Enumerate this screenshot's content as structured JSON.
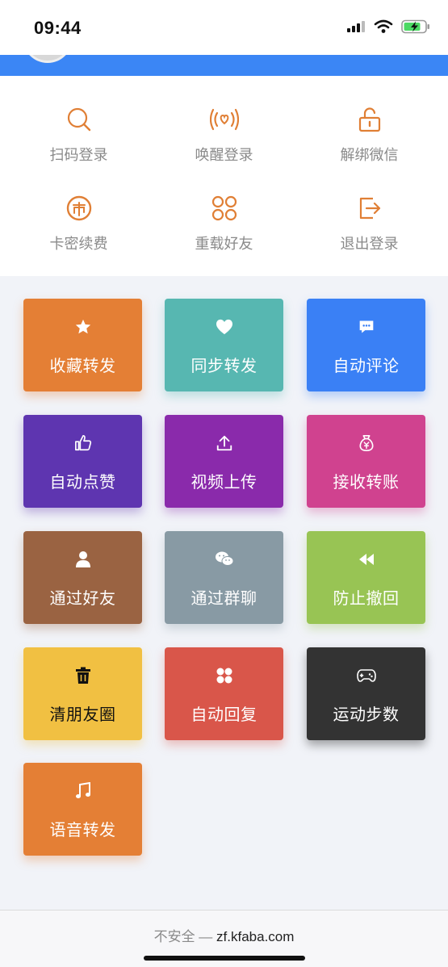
{
  "status_bar": {
    "time": "09:44"
  },
  "menu": {
    "items": [
      {
        "label": "扫码登录",
        "icon": "search-icon"
      },
      {
        "label": "唤醒登录",
        "icon": "wake-signal-icon"
      },
      {
        "label": "解绑微信",
        "icon": "unlock-icon"
      },
      {
        "label": "卡密续费",
        "icon": "coin-icon"
      },
      {
        "label": "重载好友",
        "icon": "reload-grid-icon"
      },
      {
        "label": "退出登录",
        "icon": "logout-icon"
      }
    ],
    "icon_color": "#e07f35"
  },
  "tiles": [
    {
      "label": "收藏转发",
      "icon": "star-icon",
      "color": "#e47f35"
    },
    {
      "label": "同步转发",
      "icon": "heart-icon",
      "color": "#57b7b1"
    },
    {
      "label": "自动评论",
      "icon": "comment-icon",
      "color": "#3a80f5"
    },
    {
      "label": "自动点赞",
      "icon": "thumbs-up-icon",
      "color": "#5e35b0"
    },
    {
      "label": "视频上传",
      "icon": "upload-icon",
      "color": "#8a2aab"
    },
    {
      "label": "接收转账",
      "icon": "money-bag-icon",
      "color": "#d0428f"
    },
    {
      "label": "通过好友",
      "icon": "user-icon",
      "color": "#9a6342"
    },
    {
      "label": "通过群聊",
      "icon": "wechat-icon",
      "color": "#889aa4"
    },
    {
      "label": "防止撤回",
      "icon": "rewind-icon",
      "color": "#98c454"
    },
    {
      "label": "清朋友圈",
      "icon": "trash-icon",
      "color": "#f1c042"
    },
    {
      "label": "自动回复",
      "icon": "grid-dots-icon",
      "color": "#d9564a"
    },
    {
      "label": "运动步数",
      "icon": "gamepad-icon",
      "color": "#333333"
    },
    {
      "label": "语音转发",
      "icon": "music-note-icon",
      "color": "#e47f35"
    }
  ],
  "url_bar": {
    "insecure": "不安全 — ",
    "host": "zf.kfaba.com"
  }
}
